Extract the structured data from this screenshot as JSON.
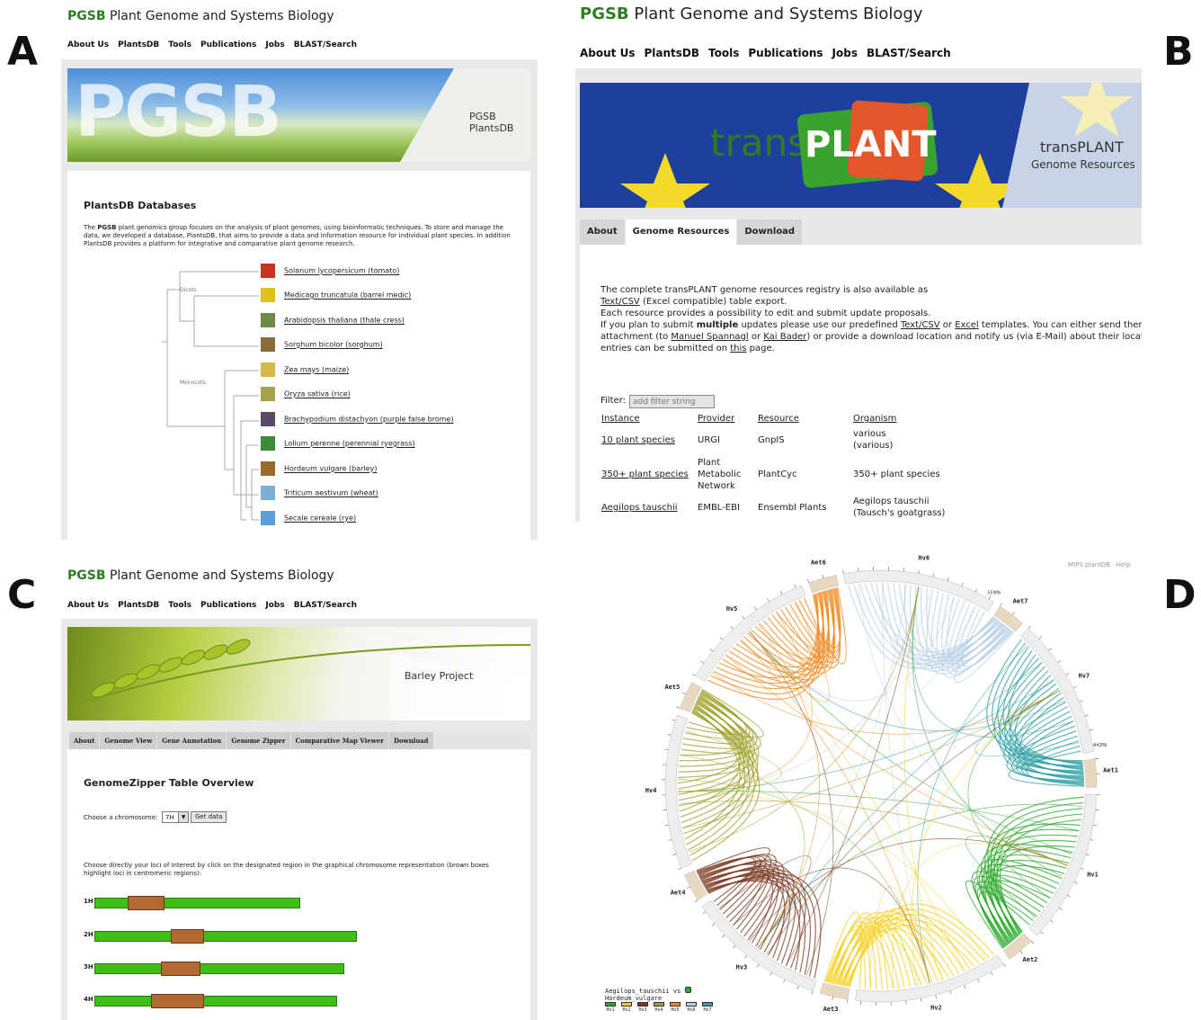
{
  "panel_letters": [
    "A",
    "B",
    "C",
    "D"
  ],
  "site": {
    "brand_short": "PGSB",
    "brand_long": "Plant Genome and Systems Biology"
  },
  "nav": [
    "About Us",
    "PlantsDB",
    "Tools",
    "Publications",
    "Jobs",
    "BLAST/Search"
  ],
  "panelA": {
    "banner_text": "PGSB",
    "banner_label": "PGSB PlantsDB",
    "heading": "PlantsDB Databases",
    "intro_bold": "PGSB",
    "intro_pre": "The ",
    "intro_post": " plant genomics group focuses on the analysis of plant genomes, using bioinformatic techniques. To store and manage the data, we developed a database, PlantsDB, that aims to provide a data and information resource for individual plant species. In addition PlantsDB provides a platform for integrative and comparative plant genome research.",
    "clade_dicots": "Dicots",
    "clade_monocots": "Monocots",
    "species": [
      "Solanum lycopersicum (tomato)",
      "Medicago truncatula (barrel medic)",
      "Arabidopsis thaliana (thale cress)",
      "Sorghum bicolor (sorghum)",
      "Zea mays (maize)",
      "Oryza sativa (rice)",
      "Brachypodium distachyon (purple false brome)",
      "Lolium perenne (perennial ryegrass)",
      "Hordeum vulgare (barley)",
      "Triticum aestivum (wheat)",
      "Secale cereale (rye)"
    ],
    "species_colors": [
      "#c8321e",
      "#e2c21a",
      "#6e8a4a",
      "#8b6a3a",
      "#d8b84a",
      "#a8a24e",
      "#5a4a6a",
      "#3c8a3a",
      "#9a6a2a",
      "#7ab0d8",
      "#5aa0d8"
    ]
  },
  "panelB": {
    "banner_word_a": "trans",
    "banner_word_b": "PLANT",
    "banner_title": "transPLANT",
    "banner_subtitle": "Genome Resources",
    "tabs": [
      "About",
      "Genome Resources",
      "Download"
    ],
    "active_tab": "Genome Resources",
    "p1": "The complete transPLANT genome resources registry is also available as",
    "p1_link": "Text/CSV",
    "p1_rest": " (Excel compatible) table export.",
    "p2": "Each resource provides a possibility to edit and submit update proposals.",
    "p3_pre": "If you plan to submit ",
    "p3_bold": "multiple",
    "p3_mid": " updates please use our predefined ",
    "p3_link1": "Text/CSV",
    "p3_or": " or ",
    "p3_link2": "Excel",
    "p3_post": " templates. You can either send them via E",
    "p4_pre": "attachment (to ",
    "p4_link1": "Manuel Spannagl",
    "p4_or": " or ",
    "p4_link2": "Kai Bader",
    "p4_post": ") or provide a download location and notify us (via E-Mail) about their location",
    "p5_pre": "entries can be submitted on ",
    "p5_link": "this",
    "p5_post": " page.",
    "filter_label": "Filter:",
    "filter_placeholder": "add filter string",
    "columns": [
      "Instance",
      "Provider",
      "Resource",
      "Organism"
    ],
    "rows": [
      {
        "instance": "10 plant species",
        "provider": "URGI",
        "resource": "GnpIS",
        "organism": "various (various)"
      },
      {
        "instance": "350+ plant species",
        "provider": "Plant Metabolic Network",
        "resource": "PlantCyc",
        "organism": "350+ plant species"
      },
      {
        "instance": "Aegilops tauschii",
        "provider": "EMBL-EBI",
        "resource": "Ensembl Plants",
        "organism": "Aegilops tauschii (Tausch's goatgrass)"
      }
    ]
  },
  "panelC": {
    "banner_label": "Barley Project",
    "tabs": [
      "About",
      "Genome View",
      "Gene Annotation",
      "Genome Zipper",
      "Comparative Map Viewer",
      "Download"
    ],
    "heading": "GenomeZipper Table Overview",
    "choose_label": "Choose a chromosome:",
    "chromosome_value": "7H",
    "get_data": "Get data",
    "instructions": "Choose directly your loci of interest by click on the designated region in the graphical chromosome representation (brown boxes highlight loci in centromeric regions):",
    "chromosomes": [
      {
        "name": "1H",
        "length": 0.62,
        "cen_start": 0.1,
        "cen_len": 0.11
      },
      {
        "name": "2H",
        "length": 0.79,
        "cen_start": 0.23,
        "cen_len": 0.1
      },
      {
        "name": "3H",
        "length": 0.75,
        "cen_start": 0.2,
        "cen_len": 0.12
      },
      {
        "name": "4H",
        "length": 0.73,
        "cen_start": 0.17,
        "cen_len": 0.16
      }
    ]
  },
  "panelD": {
    "top_links": [
      "MIPS plantDB",
      "Help"
    ],
    "chromosomes": [
      {
        "name": "Hv6",
        "size": "559Mb",
        "color": "#b8d0e6"
      },
      {
        "name": "Aet7",
        "size": "",
        "color": "#e8d8c0"
      },
      {
        "name": "Hv7",
        "size": "642Mb",
        "color": "#2f9fa3"
      },
      {
        "name": "Aet1",
        "size": "",
        "color": "#e8d8c0"
      },
      {
        "name": "Hv1",
        "size": "",
        "color": "#2aa82a"
      },
      {
        "name": "Aet2",
        "size": "",
        "color": "#e8d8c0"
      },
      {
        "name": "Hv2",
        "size": "",
        "color": "#f5d020"
      },
      {
        "name": "Aet3",
        "size": "",
        "color": "#e8d8c0"
      },
      {
        "name": "Hv3",
        "size": "",
        "color": "#7a3a22"
      },
      {
        "name": "Aet4",
        "size": "",
        "color": "#e8d8c0"
      },
      {
        "name": "Hv4",
        "size": "",
        "color": "#9ea02a"
      },
      {
        "name": "Aet5",
        "size": "",
        "color": "#e8d8c0"
      },
      {
        "name": "Hv5",
        "size": "",
        "color": "#f08a1e"
      },
      {
        "name": "Aet6",
        "size": "",
        "color": "#e8d8c0"
      }
    ],
    "legend_title": "Aegilops_tauschii vs",
    "legend_sub": "Hordeum_vulgare",
    "legend_items": [
      "Hv1",
      "Hv2",
      "Hv3",
      "Hv4",
      "Hv5",
      "Hv6",
      "Hv7"
    ],
    "legend_colors": [
      "#2aa82a",
      "#f5d020",
      "#7a3a22",
      "#9ea02a",
      "#f08a1e",
      "#b8d0e6",
      "#2f9fa3"
    ]
  }
}
